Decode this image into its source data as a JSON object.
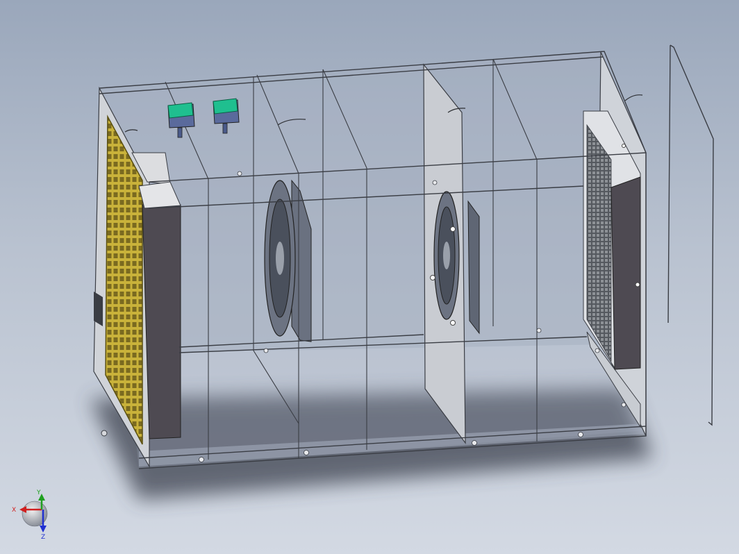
{
  "scene": {
    "background_top": "#9aa7bb",
    "background_bottom": "#d3d9e3",
    "frame_color": "#3a3d44",
    "glass_color": "#9ea9bc",
    "filter_yellow": "#c9b23a",
    "switch_green": "#1fbf8f",
    "switch_body": "#5a6a9c",
    "fan_count": 2,
    "switch_count": 2
  },
  "triad": {
    "x_label": "X",
    "y_label": "Y",
    "z_label": "Z",
    "x_color": "#d02020",
    "y_color": "#20a020",
    "z_color": "#2030d0"
  }
}
